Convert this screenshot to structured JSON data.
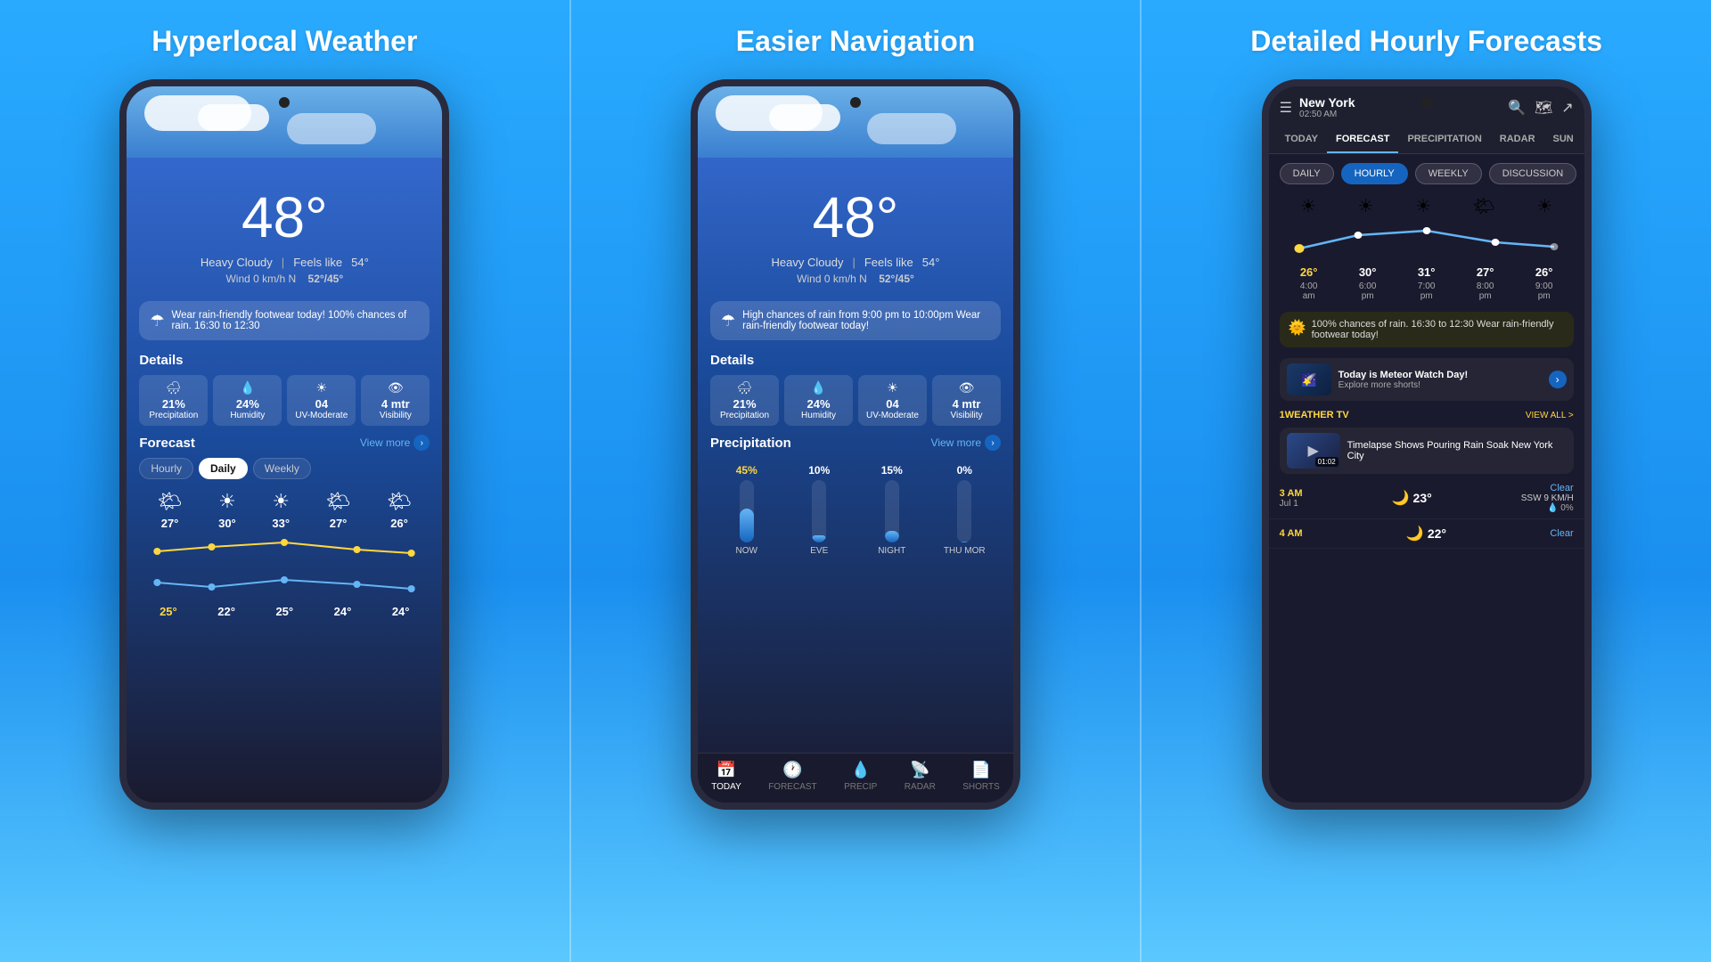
{
  "panels": [
    {
      "id": "panel-1",
      "title": "Hyperlocal Weather",
      "phone": {
        "temperature": "48°",
        "description": "Heavy Cloudy",
        "feels_like_label": "Feels like",
        "feels_like": "54°",
        "wind": "Wind 0 km/h N",
        "temp_range": "52°/45°",
        "alert": "Wear rain-friendly footwear today! 100% chances of rain. 16:30 to 12:30",
        "details_title": "Details",
        "details": [
          {
            "icon": "🌧",
            "value": "21%",
            "label": "Precipitation"
          },
          {
            "icon": "💧",
            "value": "24%",
            "label": "Humidity"
          },
          {
            "icon": "☀",
            "value": "04",
            "label": "UV-Moderate"
          },
          {
            "icon": "👁",
            "value": "4 mtr",
            "label": "Visibility"
          }
        ],
        "forecast_title": "Forecast",
        "view_more": "View more",
        "tabs": [
          "Hourly",
          "Daily",
          "Weekly"
        ],
        "active_tab": "Daily",
        "forecast_days": [
          {
            "emoji": "🌤",
            "temp": "27°"
          },
          {
            "emoji": "☀",
            "temp": "30°"
          },
          {
            "emoji": "☀",
            "temp": "33°"
          },
          {
            "emoji": "🌤",
            "temp": "27°"
          },
          {
            "emoji": "🌤",
            "temp": "26°"
          }
        ],
        "bottom_temps": [
          "25°",
          "22°",
          "25°",
          "24°",
          "24°"
        ],
        "bottom_temp_highlighted": 0
      }
    },
    {
      "id": "panel-2",
      "title": "Easier Navigation",
      "phone": {
        "temperature": "48°",
        "description": "Heavy Cloudy",
        "feels_like_label": "Feels like",
        "feels_like": "54°",
        "wind": "Wind 0 km/h N",
        "temp_range": "52°/45°",
        "alert": "High chances of rain from 9:00 pm to 10:00pm Wear rain-friendly footwear today!",
        "details_title": "Details",
        "details": [
          {
            "icon": "🌧",
            "value": "21%",
            "label": "Precipitation"
          },
          {
            "icon": "💧",
            "value": "24%",
            "label": "Humidity"
          },
          {
            "icon": "☀",
            "value": "04",
            "label": "UV-Moderate"
          },
          {
            "icon": "👁",
            "value": "4 mtr",
            "label": "Visibility"
          }
        ],
        "precip_title": "Precipitation",
        "view_more": "View more",
        "precip_bars": [
          {
            "pct": "45%",
            "fill": 55,
            "label": "NOW",
            "highlighted": true
          },
          {
            "pct": "10%",
            "fill": 12,
            "label": "EVE",
            "highlighted": false
          },
          {
            "pct": "15%",
            "fill": 18,
            "label": "NIGHT",
            "highlighted": false
          },
          {
            "pct": "0%",
            "fill": 0,
            "label": "THU MOR",
            "highlighted": false
          }
        ],
        "nav_items": [
          {
            "icon": "📅",
            "label": "TODAY",
            "active": true
          },
          {
            "icon": "🕐",
            "label": "FORECAST",
            "active": false
          },
          {
            "icon": "💧",
            "label": "PRECIP",
            "active": false
          },
          {
            "icon": "📡",
            "label": "RADAR",
            "active": false
          },
          {
            "icon": "📄",
            "label": "SHORTS",
            "active": false
          }
        ]
      }
    },
    {
      "id": "panel-3",
      "title": "Detailed Hourly Forecasts",
      "phone": {
        "city": "New York",
        "time": "02:50 AM",
        "tabs": [
          "TODAY",
          "FORECAST",
          "PRECIPITATION",
          "RADAR",
          "SUN"
        ],
        "active_tab": "FORECAST",
        "forecast_btns": [
          "DAILY",
          "HOURLY",
          "WEEKLY",
          "DISCUSSION"
        ],
        "active_btn": "HOURLY",
        "hourly": [
          {
            "emoji": "☀",
            "temp": "26°",
            "time": "4:00\nam",
            "highlighted": true
          },
          {
            "emoji": "☀",
            "temp": "30°",
            "time": "6:00\npm",
            "highlighted": false
          },
          {
            "emoji": "☀",
            "temp": "31°",
            "time": "7:00\npm",
            "highlighted": false
          },
          {
            "emoji": "🌤",
            "temp": "27°",
            "time": "8:00\npm",
            "highlighted": false
          },
          {
            "emoji": "☀",
            "temp": "26°",
            "time": "9:00\npm",
            "highlighted": false
          }
        ],
        "rain_alert": "100% chances of rain. 16:30 to 12:30 Wear rain-friendly footwear today!",
        "rain_icon": "🌞",
        "news_title": "Today is Meteor Watch Day!",
        "news_sub": "Explore more shorts!",
        "tv_label": "1WEATHER TV",
        "view_all": "VIEW ALL >",
        "tv_title": "Timelapse Shows Pouring Rain Soak New York City",
        "tv_duration": "01:02",
        "rows": [
          {
            "time": "3 AM",
            "date": "Jul 1",
            "moon_icon": "🌙",
            "temp": "23°",
            "desc": "Clear",
            "wind": "SSW 9 KM/H",
            "precip_icon": "💧",
            "precip": "0%"
          },
          {
            "time": "4 AM",
            "date": "",
            "moon_icon": "🌙",
            "temp": "22°",
            "desc": "Clear",
            "wind": "",
            "precip_icon": "",
            "precip": ""
          }
        ]
      }
    }
  ]
}
